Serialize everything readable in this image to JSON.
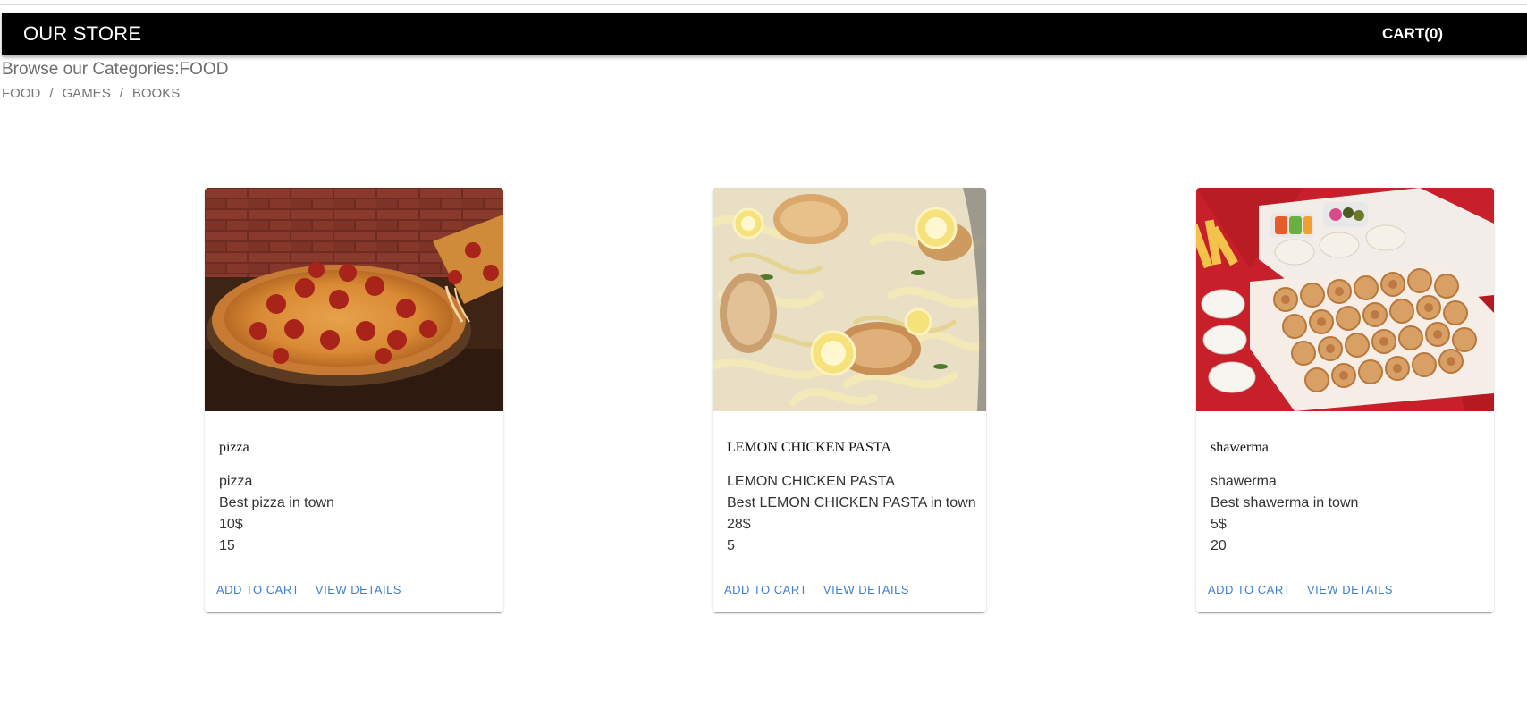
{
  "header": {
    "brand": "OUR STORE",
    "cart_label": "CART(0)"
  },
  "browse": {
    "text": "Browse our Categories:FOOD"
  },
  "breadcrumbs": [
    {
      "label": "FOOD"
    },
    {
      "label": "GAMES"
    },
    {
      "label": "BOOKS"
    }
  ],
  "breadcrumb_separator": "/",
  "products": [
    {
      "title": "pizza",
      "name": "pizza",
      "description": "Best pizza in town",
      "price": "10$",
      "quantity": "15",
      "add_to_cart": "ADD TO CART",
      "view_details": "VIEW DETAILS"
    },
    {
      "title": "LEMON CHICKEN PASTA",
      "name": "LEMON CHICKEN PASTA",
      "description": "Best LEMON CHICKEN PASTA in town",
      "price": "28$",
      "quantity": "5",
      "add_to_cart": "ADD TO CART",
      "view_details": "VIEW DETAILS"
    },
    {
      "title": "shawerma",
      "name": "shawerma",
      "description": "Best shawerma in town",
      "price": "5$",
      "quantity": "20",
      "add_to_cart": "ADD TO CART",
      "view_details": "VIEW DETAILS"
    }
  ],
  "colors": {
    "appbar": "#000000",
    "action_text": "#3f7fd0",
    "muted_text": "#757575"
  }
}
